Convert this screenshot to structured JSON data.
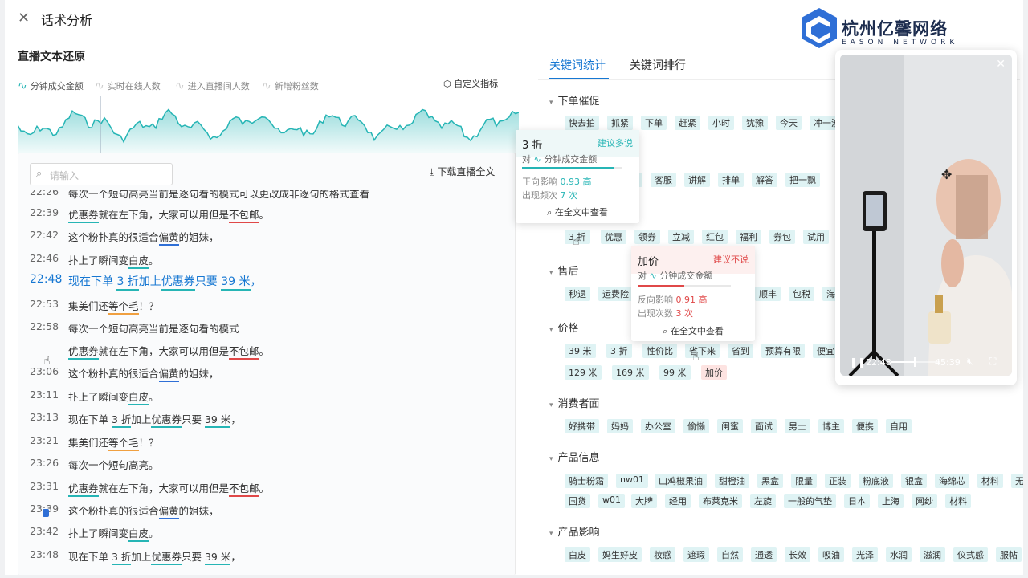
{
  "window": {
    "title": "话术分析",
    "close_icon": "close-icon"
  },
  "logo": {
    "name": "杭州亿馨网络",
    "subtitle": "EASON NETWORK"
  },
  "left": {
    "section_title": "直播文本还原",
    "metrics": [
      {
        "label": "分钟成交金额",
        "active": true
      },
      {
        "label": "实时在线人数",
        "active": false
      },
      {
        "label": "进入直播间人数",
        "active": false
      },
      {
        "label": "新增粉丝数",
        "active": false
      }
    ],
    "custom_metric": "自定义指标",
    "search_placeholder": "请输入",
    "download_label": "下载直播全文",
    "transcript": [
      {
        "time": "22:26",
        "parts": [
          {
            "text": "每次一个短句高亮当前是逐句看的模式可以更改成非逐句的格式查看"
          }
        ]
      },
      {
        "time": "22:39",
        "parts": [
          {
            "text": "优惠券",
            "u": "teal"
          },
          {
            "text": "就在左下角，大家可以用但是"
          },
          {
            "text": "不包邮",
            "u": "red"
          },
          {
            "text": "。"
          }
        ]
      },
      {
        "time": "22:42",
        "parts": [
          {
            "text": "这个粉扑真的很适合"
          },
          {
            "text": "偏黄",
            "u": "blue"
          },
          {
            "text": "的姐妹，"
          }
        ]
      },
      {
        "time": "22:46",
        "parts": [
          {
            "text": "扑上了瞬间变"
          },
          {
            "text": "白皮",
            "u": "teal"
          },
          {
            "text": "。"
          }
        ]
      },
      {
        "time": "22:48",
        "highlight": true,
        "parts": [
          {
            "text": "现在下单 "
          },
          {
            "text": "3 折",
            "u": "teal"
          },
          {
            "text": "加上"
          },
          {
            "text": "优惠券",
            "u": "teal"
          },
          {
            "text": "只要 "
          },
          {
            "text": "39 米",
            "u": "teal"
          },
          {
            "text": "，"
          }
        ]
      },
      {
        "time": "22:53",
        "parts": [
          {
            "text": "集美们还"
          },
          {
            "text": "等个毛",
            "u": "orange"
          },
          {
            "text": "！？"
          }
        ]
      },
      {
        "time": "22:58",
        "parts": [
          {
            "text": "每次一个短句高亮当前是逐句看的模式"
          }
        ]
      },
      {
        "time": "",
        "parts": [
          {
            "text": "优惠券",
            "u": "teal"
          },
          {
            "text": "就在左下角，大家可以用但是"
          },
          {
            "text": "不包邮",
            "u": "red"
          },
          {
            "text": "。"
          }
        ]
      },
      {
        "time": "23:06",
        "parts": [
          {
            "text": "这个粉扑真的很适合"
          },
          {
            "text": "偏黄",
            "u": "blue"
          },
          {
            "text": "的姐妹，"
          }
        ]
      },
      {
        "time": "23:11",
        "parts": [
          {
            "text": "扑上了瞬间变"
          },
          {
            "text": "白皮",
            "u": "teal"
          },
          {
            "text": "。"
          }
        ]
      },
      {
        "time": "23:13",
        "parts": [
          {
            "text": "现在下单 "
          },
          {
            "text": "3 折",
            "u": "teal"
          },
          {
            "text": "加上"
          },
          {
            "text": "优惠券",
            "u": "teal"
          },
          {
            "text": "只要 "
          },
          {
            "text": "39 米",
            "u": "teal"
          },
          {
            "text": "，"
          }
        ]
      },
      {
        "time": "23:21",
        "parts": [
          {
            "text": "集美们还"
          },
          {
            "text": "等个毛",
            "u": "orange"
          },
          {
            "text": "！？"
          }
        ]
      },
      {
        "time": "23:26",
        "parts": [
          {
            "text": "每次一个短句高亮。"
          }
        ]
      },
      {
        "time": "23:31",
        "parts": [
          {
            "text": "优惠券",
            "u": "teal"
          },
          {
            "text": "就在左下角，大家可以用但是"
          },
          {
            "text": "不包邮",
            "u": "red"
          },
          {
            "text": "。"
          }
        ]
      },
      {
        "time": "23:39",
        "parts": [
          {
            "text": "这个粉扑真的很适合"
          },
          {
            "text": "偏黄",
            "u": "blue"
          },
          {
            "text": "的姐妹，"
          }
        ]
      },
      {
        "time": "23:42",
        "parts": [
          {
            "text": "扑上了瞬间变"
          },
          {
            "text": "白皮",
            "u": "teal"
          },
          {
            "text": "。"
          }
        ]
      },
      {
        "time": "23:48",
        "parts": [
          {
            "text": "现在下单 "
          },
          {
            "text": "3 折",
            "u": "teal"
          },
          {
            "text": "加上"
          },
          {
            "text": "优惠券",
            "u": "teal"
          },
          {
            "text": "只要 "
          },
          {
            "text": "39 米",
            "u": "teal"
          },
          {
            "text": "，"
          }
        ]
      }
    ]
  },
  "right": {
    "tabs": [
      "关键词统计",
      "关键词排行"
    ],
    "active_tab": 0,
    "categories": [
      {
        "name": "下单催促",
        "rows": [
          [
            "快去拍",
            "抓紧",
            "下单",
            "赶紧",
            "小时",
            "犹豫",
            "今天",
            "冲一波"
          ]
        ]
      },
      {
        "name": "",
        "rows": [
          [
            "关注",
            "客服",
            "讲解",
            "排单",
            "解答",
            "把一飘"
          ]
        ]
      },
      {
        "name": "",
        "rows": [
          [
            "3 折",
            "优惠",
            "领券",
            "立减",
            "红包",
            "福利",
            "券包",
            "试用",
            "礼盒"
          ]
        ]
      },
      {
        "name": "售后",
        "rows": [
          [
            "秒退",
            "运费险",
            "顺丰",
            "包税",
            "海关"
          ]
        ]
      },
      {
        "name": "价格",
        "rows": [
          [
            "39 米",
            "3 折",
            "性价比",
            "省下来",
            "省到",
            "预算有限",
            "便宜",
            "32"
          ],
          [
            "129 米",
            "169 米",
            "99 米",
            "加价"
          ]
        ]
      },
      {
        "name": "消费者面",
        "rows": [
          [
            "好携带",
            "妈妈",
            "办公室",
            "偷懒",
            "闺蜜",
            "面试",
            "男士",
            "博主",
            "便携",
            "自用"
          ]
        ]
      },
      {
        "name": "产品信息",
        "rows": [
          [
            "骑士粉霜",
            "nw01",
            "山鸡椒果油",
            "甜橙油",
            "黑盒",
            "限量",
            "正装",
            "粉底液",
            "银盒",
            "海绵芯",
            "材料",
            "无害"
          ],
          [
            "国货",
            "w01",
            "大牌",
            "经用",
            "布莱克米",
            "左旋",
            "一般的气垫",
            "日本",
            "上海",
            "网纱",
            "材料"
          ]
        ]
      },
      {
        "name": "产品影响",
        "rows": [
          [
            "白皮",
            "妈生好皮",
            "妆感",
            "遮瑕",
            "自然",
            "通透",
            "长效",
            "吸油",
            "光泽",
            "水润",
            "滋润",
            "仪式感",
            "服帖"
          ]
        ]
      }
    ]
  },
  "tooltips": [
    {
      "keyword": "3 折",
      "advice": "建议多说",
      "vs_prefix": "对",
      "metric": "分钟成交金额",
      "effect_label": "正向影响",
      "effect_value": "0.93 高",
      "count_label": "出现频次",
      "count_value": "7 次",
      "find_label": "在全文中查看",
      "effect_level": 0.93,
      "color": "#26b5b5"
    },
    {
      "keyword": "加价",
      "advice": "建议不说",
      "vs_prefix": "对",
      "metric": "分钟成交金额",
      "effect_label": "反向影响",
      "effect_value": "0.91 高",
      "count_label": "出现次数",
      "count_value": "3 次",
      "find_label": "在全文中查看",
      "effect_level": 0.91,
      "color": "#e04848"
    }
  ],
  "video": {
    "current_time": "22:48",
    "duration": "45:39",
    "progress": 0.5
  },
  "icons": {
    "search": "search-icon",
    "download": "download-icon",
    "settings": "settings-icon",
    "wave": "wave-icon",
    "move": "move-icon"
  }
}
